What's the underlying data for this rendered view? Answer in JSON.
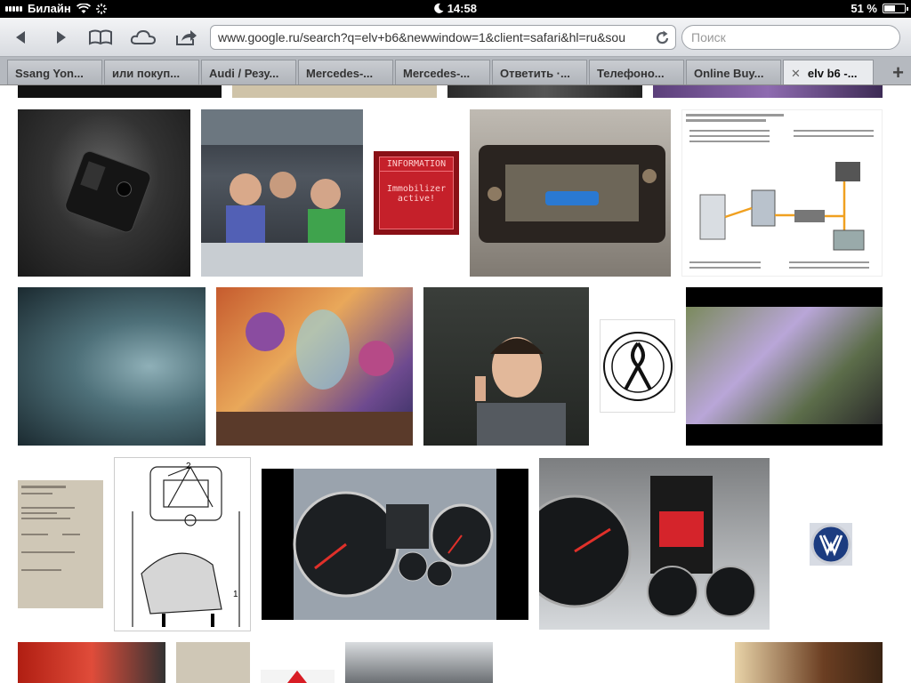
{
  "status": {
    "carrier": "Билайн",
    "time": "14:58",
    "battery": "51 %"
  },
  "toolbar": {
    "url": "www.google.ru/search?q=elv+b6&newwindow=1&client=safari&hl=ru&sou",
    "search_placeholder": "Поиск"
  },
  "tabs": [
    {
      "label": "Ssang Yon..."
    },
    {
      "label": "или покуп..."
    },
    {
      "label": "Audi / Резу..."
    },
    {
      "label": "Mercedes-..."
    },
    {
      "label": "Mercedes-..."
    },
    {
      "label": "Ответить ·..."
    },
    {
      "label": "Телефоно..."
    },
    {
      "label": "Online Buy..."
    },
    {
      "label": "elv b6 -..."
    }
  ],
  "tab_close_symbol": "✕",
  "add_tab_symbol": "+",
  "images": {
    "info_line1": "INFORMATION",
    "info_line2": "Immobilizer",
    "info_line3": "active!",
    "diagram_label": "2",
    "diagram_label2": "1"
  },
  "colors": {
    "accent": "#4b8df0",
    "statusbar": "#000000"
  }
}
